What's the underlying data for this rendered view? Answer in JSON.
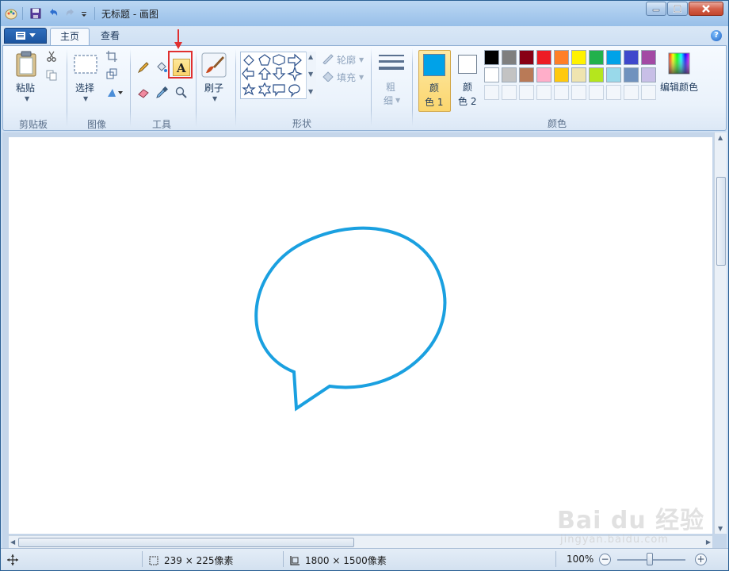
{
  "window": {
    "title": "无标题 - 画图"
  },
  "tabs": [
    {
      "label": "主页"
    },
    {
      "label": "查看"
    }
  ],
  "ribbon": {
    "clipboard": {
      "paste_label": "粘贴",
      "group_label": "剪贴板"
    },
    "image": {
      "select_label": "选择",
      "group_label": "图像"
    },
    "tools": {
      "group_label": "工具"
    },
    "brushes": {
      "label": "刷子"
    },
    "shapes": {
      "outline_label": "轮廓",
      "fill_label": "填充",
      "group_label": "形状"
    },
    "size": {
      "label_top": "粗",
      "label_bottom": "细"
    },
    "colors": {
      "color1_top": "颜",
      "color1_bottom": "色 1",
      "color2_top": "颜",
      "color2_bottom": "色 2",
      "edit_label": "编辑颜色",
      "group_label": "颜色",
      "color1_value": "#00a2e8",
      "color2_value": "#ffffff",
      "palette_row1": [
        "#000000",
        "#7f7f7f",
        "#880015",
        "#ed1c24",
        "#ff7f27",
        "#fff200",
        "#22b14c",
        "#00a2e8",
        "#3f48cc",
        "#a349a4"
      ],
      "palette_row2": [
        "#ffffff",
        "#c3c3c3",
        "#b97a57",
        "#ffaec9",
        "#ffc90e",
        "#efe4b0",
        "#b5e61d",
        "#99d9ea",
        "#7092be",
        "#c8bfe7"
      ]
    }
  },
  "canvas": {
    "shape": "speech-bubble",
    "stroke_color": "#1aa0e0"
  },
  "status": {
    "selection_size": "239 × 225像素",
    "canvas_size": "1800 × 1500像素",
    "zoom": "100%"
  },
  "watermark": {
    "main": "Bai du 经验",
    "sub": "jingyan.baidu.com"
  }
}
